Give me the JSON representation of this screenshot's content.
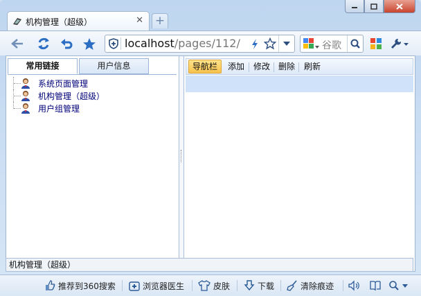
{
  "browser": {
    "tab_title": "机构管理（超级）",
    "new_tab_label": "+",
    "address": {
      "host": "localhost",
      "path": "/pages/112/"
    },
    "search": {
      "placeholder": "谷歌"
    }
  },
  "left_panel": {
    "tabs": [
      {
        "label": "常用链接",
        "active": true
      },
      {
        "label": "用户信息",
        "active": false
      }
    ],
    "tree": [
      {
        "label": "系统页面管理"
      },
      {
        "label": "机构管理（超级）"
      },
      {
        "label": "用户组管理"
      }
    ]
  },
  "right_panel": {
    "toolbar": [
      {
        "label": "导航栏",
        "active": true
      },
      {
        "label": "添加",
        "active": false
      },
      {
        "label": "修改",
        "active": false
      },
      {
        "label": "删除",
        "active": false
      },
      {
        "label": "刷新",
        "active": false
      }
    ]
  },
  "status_text": "机构管理（超级）",
  "bottom_bar": {
    "items": [
      {
        "label": "推荐到360搜索",
        "icon": "thumbs-up-icon"
      },
      {
        "label": "浏览器医生",
        "icon": "medical-kit-icon"
      },
      {
        "label": "皮肤",
        "icon": "shirt-icon"
      },
      {
        "label": "下载",
        "icon": "download-icon"
      },
      {
        "label": "清除痕迹",
        "icon": "broom-icon"
      }
    ]
  },
  "colors": {
    "accent": "#f7c24d",
    "link": "#00007a",
    "chrome": "#bfd6f0"
  }
}
